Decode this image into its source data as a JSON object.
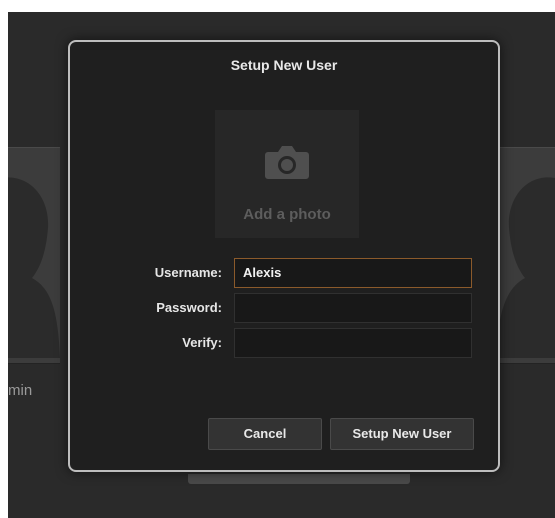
{
  "background": {
    "partial_user_label": "min"
  },
  "dialog": {
    "title": "Setup New User",
    "photo": {
      "icon": "camera-icon",
      "label": "Add a photo"
    },
    "fields": {
      "username": {
        "label": "Username:",
        "value": "Alexis"
      },
      "password": {
        "label": "Password:",
        "value": ""
      },
      "verify": {
        "label": "Verify:",
        "value": ""
      }
    },
    "buttons": {
      "cancel": "Cancel",
      "setup": "Setup New User"
    }
  },
  "colors": {
    "background": "#2a2a2a",
    "dialog": "#1f1f1f",
    "focus_border": "#8b5a2b"
  }
}
